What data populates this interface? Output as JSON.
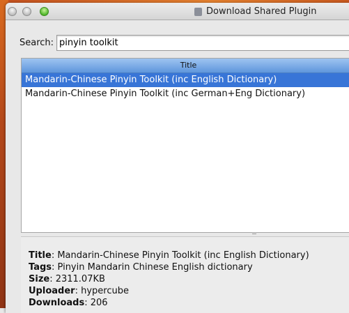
{
  "window": {
    "title": "Download Shared Plugin"
  },
  "search": {
    "label": "Search:",
    "value": "pinyin toolkit"
  },
  "table": {
    "columns": [
      "Title"
    ],
    "rows": [
      "Mandarin-Chinese Pinyin Toolkit (inc English Dictionary)",
      "Mandarin-Chinese Pinyin Toolkit (inc German+Eng Dictionary)"
    ],
    "selected_index": 0
  },
  "details": {
    "title_label": "Title",
    "title_value": "Mandarin-Chinese Pinyin Toolkit (inc English Dictionary)",
    "tags_label": "Tags",
    "tags_value": "Pinyin Mandarin Chinese English dictionary",
    "size_label": "Size",
    "size_value": "2311.07KB",
    "uploader_label": "Uploader",
    "uploader_value": "hypercube",
    "downloads_label": "Downloads",
    "downloads_value": "206"
  },
  "colors": {
    "selection": "#3875d7",
    "header": "#5f96dc",
    "zoom_button": "#4fb52a"
  },
  "icons": [
    "close-button",
    "minimize-button",
    "zoom-button",
    "plugin-icon"
  ]
}
